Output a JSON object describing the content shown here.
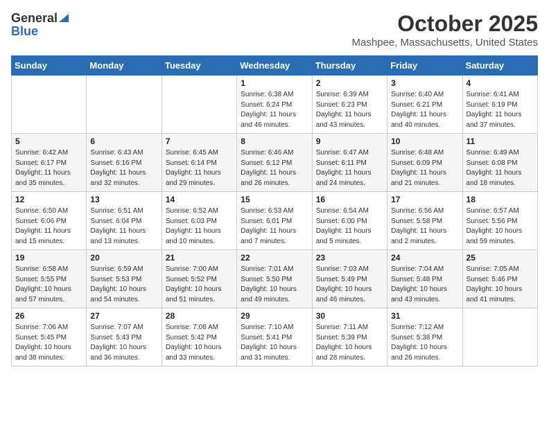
{
  "logo": {
    "general": "General",
    "blue": "Blue"
  },
  "title": "October 2025",
  "location": "Mashpee, Massachusetts, United States",
  "weekdays": [
    "Sunday",
    "Monday",
    "Tuesday",
    "Wednesday",
    "Thursday",
    "Friday",
    "Saturday"
  ],
  "weeks": [
    [
      {
        "day": "",
        "info": ""
      },
      {
        "day": "",
        "info": ""
      },
      {
        "day": "",
        "info": ""
      },
      {
        "day": "1",
        "info": "Sunrise: 6:38 AM\nSunset: 6:24 PM\nDaylight: 11 hours\nand 46 minutes."
      },
      {
        "day": "2",
        "info": "Sunrise: 6:39 AM\nSunset: 6:23 PM\nDaylight: 11 hours\nand 43 minutes."
      },
      {
        "day": "3",
        "info": "Sunrise: 6:40 AM\nSunset: 6:21 PM\nDaylight: 11 hours\nand 40 minutes."
      },
      {
        "day": "4",
        "info": "Sunrise: 6:41 AM\nSunset: 6:19 PM\nDaylight: 11 hours\nand 37 minutes."
      }
    ],
    [
      {
        "day": "5",
        "info": "Sunrise: 6:42 AM\nSunset: 6:17 PM\nDaylight: 11 hours\nand 35 minutes."
      },
      {
        "day": "6",
        "info": "Sunrise: 6:43 AM\nSunset: 6:16 PM\nDaylight: 11 hours\nand 32 minutes."
      },
      {
        "day": "7",
        "info": "Sunrise: 6:45 AM\nSunset: 6:14 PM\nDaylight: 11 hours\nand 29 minutes."
      },
      {
        "day": "8",
        "info": "Sunrise: 6:46 AM\nSunset: 6:12 PM\nDaylight: 11 hours\nand 26 minutes."
      },
      {
        "day": "9",
        "info": "Sunrise: 6:47 AM\nSunset: 6:11 PM\nDaylight: 11 hours\nand 24 minutes."
      },
      {
        "day": "10",
        "info": "Sunrise: 6:48 AM\nSunset: 6:09 PM\nDaylight: 11 hours\nand 21 minutes."
      },
      {
        "day": "11",
        "info": "Sunrise: 6:49 AM\nSunset: 6:08 PM\nDaylight: 11 hours\nand 18 minutes."
      }
    ],
    [
      {
        "day": "12",
        "info": "Sunrise: 6:50 AM\nSunset: 6:06 PM\nDaylight: 11 hours\nand 15 minutes."
      },
      {
        "day": "13",
        "info": "Sunrise: 6:51 AM\nSunset: 6:04 PM\nDaylight: 11 hours\nand 13 minutes."
      },
      {
        "day": "14",
        "info": "Sunrise: 6:52 AM\nSunset: 6:03 PM\nDaylight: 11 hours\nand 10 minutes."
      },
      {
        "day": "15",
        "info": "Sunrise: 6:53 AM\nSunset: 6:01 PM\nDaylight: 11 hours\nand 7 minutes."
      },
      {
        "day": "16",
        "info": "Sunrise: 6:54 AM\nSunset: 6:00 PM\nDaylight: 11 hours\nand 5 minutes."
      },
      {
        "day": "17",
        "info": "Sunrise: 6:56 AM\nSunset: 5:58 PM\nDaylight: 11 hours\nand 2 minutes."
      },
      {
        "day": "18",
        "info": "Sunrise: 6:57 AM\nSunset: 5:56 PM\nDaylight: 10 hours\nand 59 minutes."
      }
    ],
    [
      {
        "day": "19",
        "info": "Sunrise: 6:58 AM\nSunset: 5:55 PM\nDaylight: 10 hours\nand 57 minutes."
      },
      {
        "day": "20",
        "info": "Sunrise: 6:59 AM\nSunset: 5:53 PM\nDaylight: 10 hours\nand 54 minutes."
      },
      {
        "day": "21",
        "info": "Sunrise: 7:00 AM\nSunset: 5:52 PM\nDaylight: 10 hours\nand 51 minutes."
      },
      {
        "day": "22",
        "info": "Sunrise: 7:01 AM\nSunset: 5:50 PM\nDaylight: 10 hours\nand 49 minutes."
      },
      {
        "day": "23",
        "info": "Sunrise: 7:03 AM\nSunset: 5:49 PM\nDaylight: 10 hours\nand 46 minutes."
      },
      {
        "day": "24",
        "info": "Sunrise: 7:04 AM\nSunset: 5:48 PM\nDaylight: 10 hours\nand 43 minutes."
      },
      {
        "day": "25",
        "info": "Sunrise: 7:05 AM\nSunset: 5:46 PM\nDaylight: 10 hours\nand 41 minutes."
      }
    ],
    [
      {
        "day": "26",
        "info": "Sunrise: 7:06 AM\nSunset: 5:45 PM\nDaylight: 10 hours\nand 38 minutes."
      },
      {
        "day": "27",
        "info": "Sunrise: 7:07 AM\nSunset: 5:43 PM\nDaylight: 10 hours\nand 36 minutes."
      },
      {
        "day": "28",
        "info": "Sunrise: 7:08 AM\nSunset: 5:42 PM\nDaylight: 10 hours\nand 33 minutes."
      },
      {
        "day": "29",
        "info": "Sunrise: 7:10 AM\nSunset: 5:41 PM\nDaylight: 10 hours\nand 31 minutes."
      },
      {
        "day": "30",
        "info": "Sunrise: 7:11 AM\nSunset: 5:39 PM\nDaylight: 10 hours\nand 28 minutes."
      },
      {
        "day": "31",
        "info": "Sunrise: 7:12 AM\nSunset: 5:38 PM\nDaylight: 10 hours\nand 26 minutes."
      },
      {
        "day": "",
        "info": ""
      }
    ]
  ]
}
